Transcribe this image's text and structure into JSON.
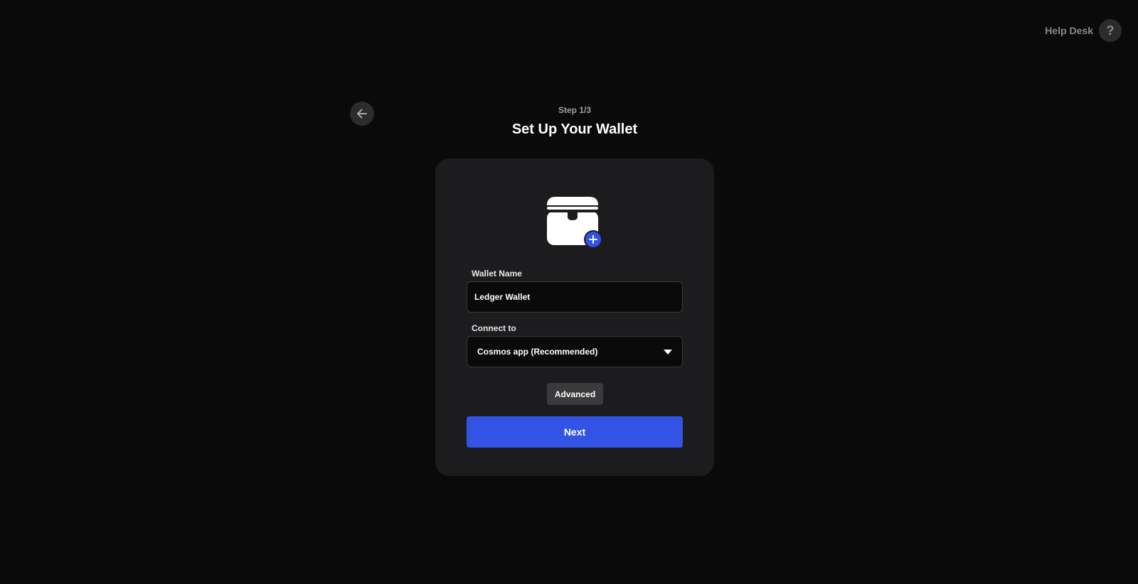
{
  "header": {
    "help_desk_label": "Help Desk",
    "help_icon_glyph": "?"
  },
  "stepper": {
    "step_label": "Step 1/3",
    "title": "Set Up Your Wallet"
  },
  "form": {
    "wallet_name_label": "Wallet Name",
    "wallet_name_value": "Ledger Wallet",
    "connect_to_label": "Connect to",
    "connect_to_value": "Cosmos app (Recommended)",
    "advanced_label": "Advanced",
    "next_label": "Next"
  },
  "icons": {
    "back": "arrow-left-icon",
    "help": "question-mark-icon",
    "wallet": "wallet-add-icon",
    "dropdown": "caret-down-icon"
  },
  "colors": {
    "background": "#0a0a0a",
    "card": "#1c1c1e",
    "accent": "#3353e4",
    "muted_button": "#3a3a3c"
  }
}
